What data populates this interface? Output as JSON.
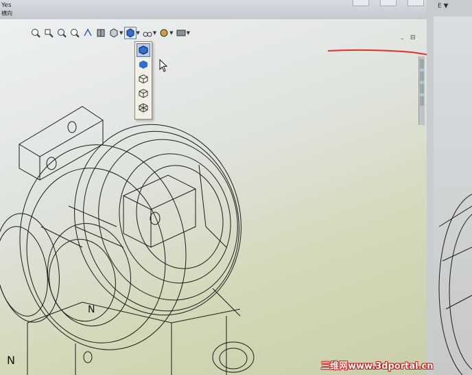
{
  "window": {
    "menu_label": "Yes",
    "sub_label": "横向"
  },
  "heads_up_toolbar": {
    "icons": [
      "zoom-to-fit-icon",
      "zoom-to-area-icon",
      "previous-view-icon",
      "zoom-in-out-icon",
      "rotate-view-icon",
      "section-view-icon",
      "view-orientation-icon",
      "display-style-icon",
      "hide-show-items-icon",
      "edit-appearance-icon",
      "apply-scene-icon",
      "view-settings-icon"
    ]
  },
  "display_style_dropdown": {
    "items": [
      "shaded-with-edges-icon",
      "shaded-icon",
      "hidden-lines-removed-icon",
      "hidden-lines-visible-icon",
      "wireframe-icon"
    ]
  },
  "viewport_controls": {
    "minimize": "–",
    "restore": "⊟"
  },
  "right_window": {
    "label": "E ▼"
  },
  "watermark": {
    "text": "三维网www.3dportal.cn"
  },
  "annotations": {
    "red_stroke_color": "#e0302a"
  },
  "model_labels": {
    "a": "N",
    "b": "N"
  }
}
